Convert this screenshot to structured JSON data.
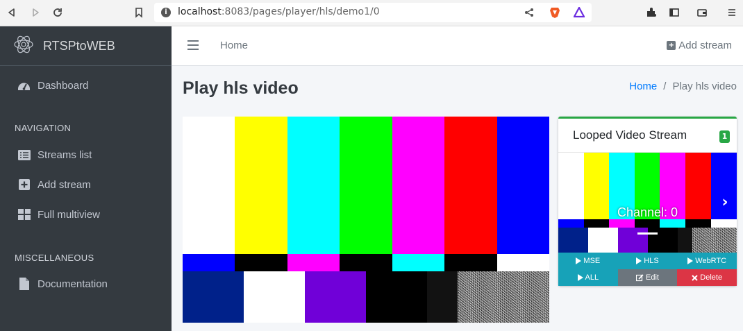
{
  "browser": {
    "url_host": "localhost",
    "url_path": ":8083/pages/player/hls/demo1/0"
  },
  "sidebar": {
    "brand": "RTSPtoWEB",
    "items": [
      {
        "label": "Dashboard",
        "icon": "dashboard-icon"
      },
      {
        "label": "Streams list",
        "icon": "list-icon"
      },
      {
        "label": "Add stream",
        "icon": "plus-square-icon"
      },
      {
        "label": "Full multiview",
        "icon": "grid-icon"
      },
      {
        "label": "Documentation",
        "icon": "file-icon"
      }
    ],
    "headers": {
      "navigation": "NAVIGATION",
      "misc": "MISCELLANEOUS"
    }
  },
  "navbar": {
    "home": "Home",
    "add_stream": "Add stream"
  },
  "content": {
    "title": "Play hls video",
    "breadcrumb": {
      "home": "Home",
      "sep": "/",
      "active": "Play hls video"
    }
  },
  "card": {
    "title": "Looped Video Stream",
    "badge": "1",
    "channel": "Channel: 0",
    "buttons_row1": [
      "MSE",
      "HLS",
      "WebRTC"
    ],
    "buttons_row2": [
      "ALL",
      "Edit",
      "Delete"
    ]
  },
  "colors": {
    "sidebar_bg": "#343a40",
    "link": "#007bff",
    "success": "#28a745",
    "info": "#17a2b8",
    "secondary": "#6c757d",
    "danger": "#dc3545"
  }
}
